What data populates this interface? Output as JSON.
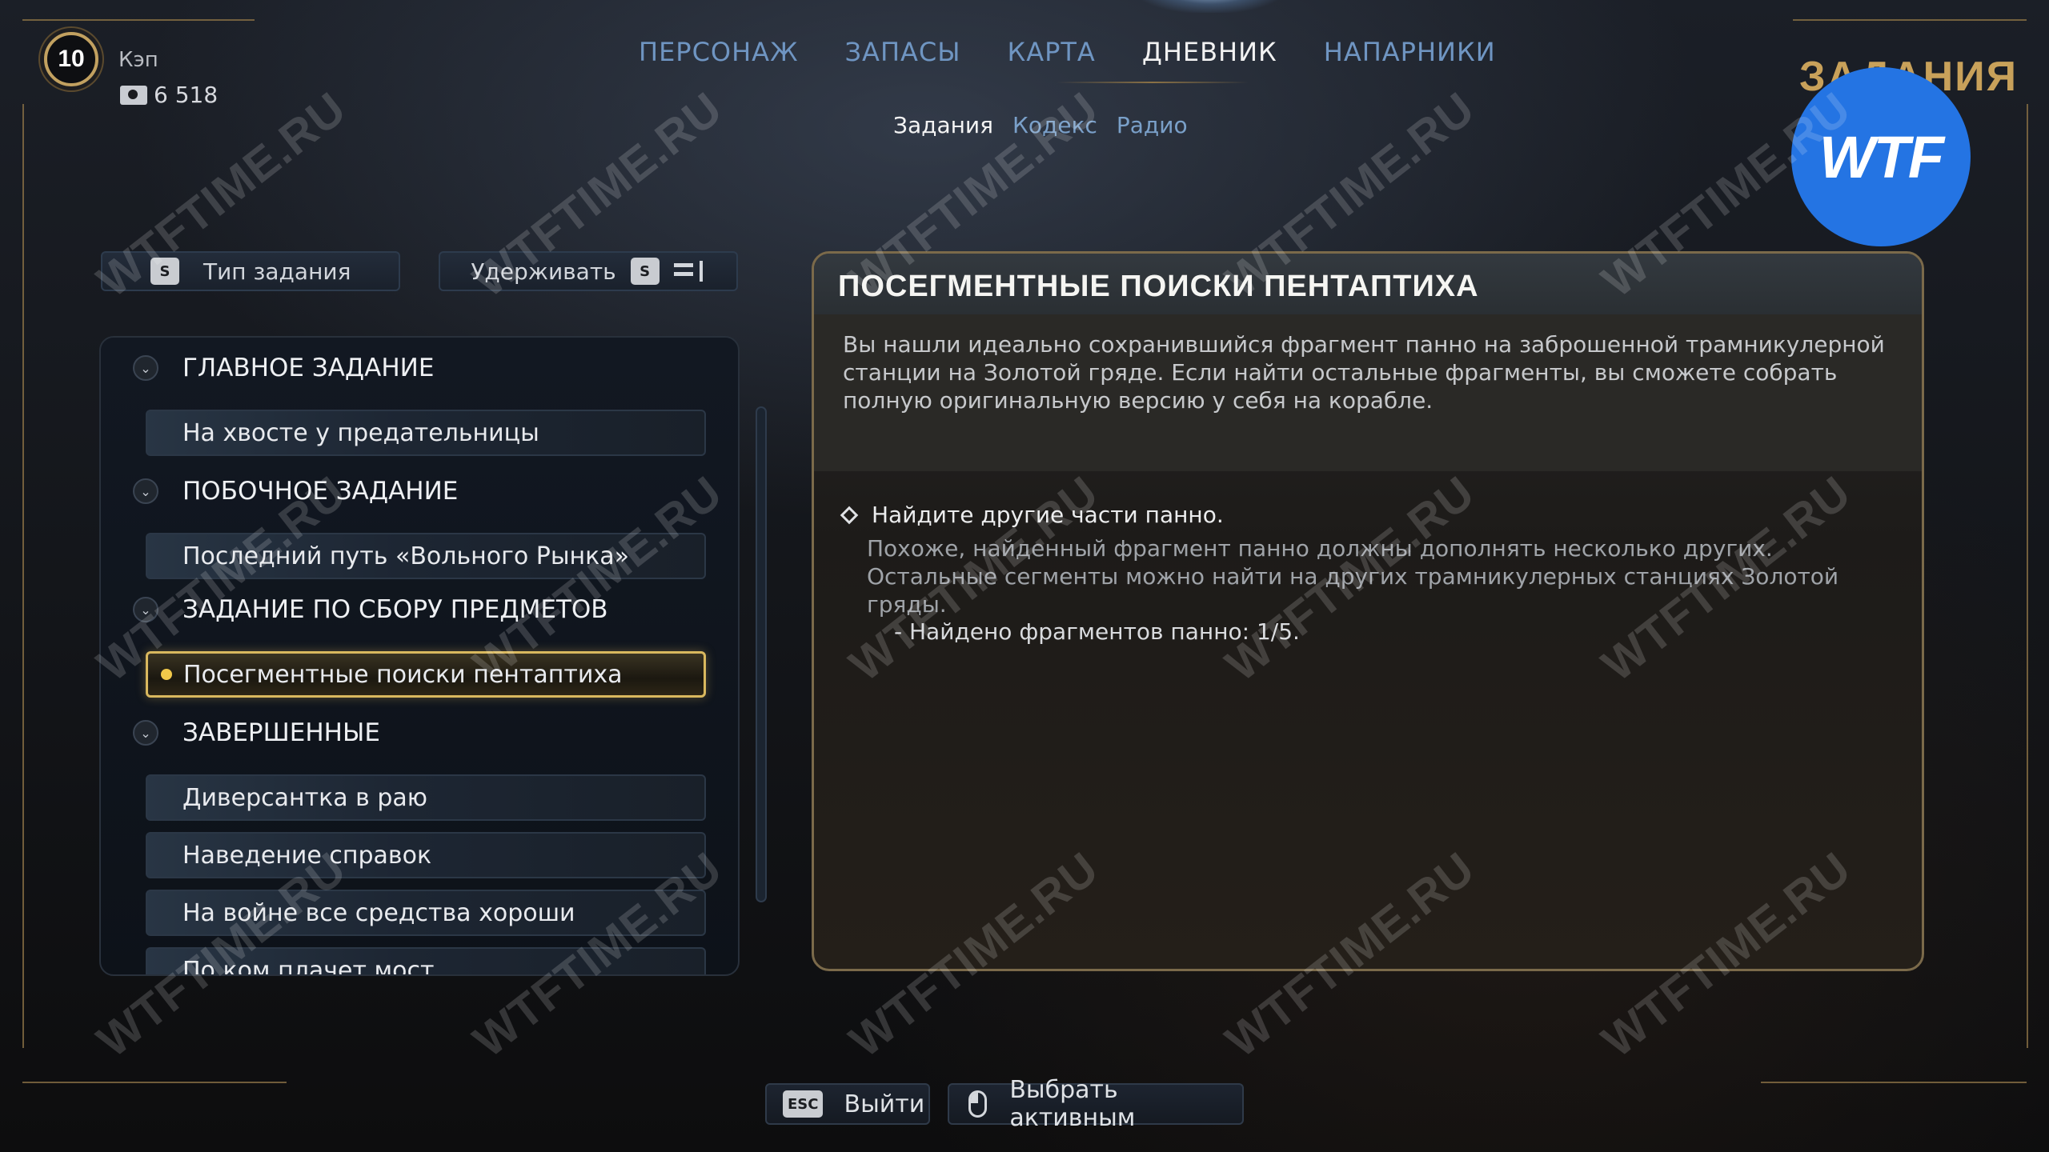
{
  "player": {
    "level": "10",
    "name": "Кэп",
    "money": "6 518"
  },
  "nav": {
    "tabs": [
      "ПЕРСОНАЖ",
      "ЗАПАСЫ",
      "КАРТА",
      "ДНЕВНИК",
      "НАПАРНИКИ"
    ],
    "active_tab": "ДНЕВНИК",
    "subtabs": [
      "Задания",
      "Кодекс",
      "Радио"
    ],
    "active_subtab": "Задания"
  },
  "section_title": "ЗАДАНИЯ",
  "watermark": {
    "badge": "WTF",
    "text": "WTFTIME.RU"
  },
  "controls": {
    "filter_key": "S",
    "filter_label": "Тип задания",
    "hold_label": "Удерживать",
    "hold_key": "S"
  },
  "quest_list": {
    "categories": [
      {
        "title": "ГЛАВНОЕ ЗАДАНИЕ",
        "items": [
          "На хвосте у предательницы"
        ]
      },
      {
        "title": "ПОБОЧНОЕ ЗАДАНИЕ",
        "items": [
          "Последний путь «Вольного Рынка»"
        ]
      },
      {
        "title": "ЗАДАНИЕ ПО СБОРУ ПРЕДМЕТОВ",
        "items": [
          "Посегментные поиски пентаптиха"
        ]
      },
      {
        "title": "ЗАВЕРШЕННЫЕ",
        "items": [
          "Диверсантка в раю",
          "Наведение справок",
          "На войне все средства хороши",
          "По ком плачет мост"
        ]
      }
    ],
    "active_item": "Посегментные поиски пентаптиха"
  },
  "detail": {
    "title": "ПОСЕГМЕНТНЫЕ ПОИСКИ ПЕНТАПТИХА",
    "description": "Вы нашли идеально сохранившийся фрагмент панно на заброшенной трамникулерной станции на Золотой гряде. Если найти остальные фрагменты, вы сможете собрать полную оригинальную версию у себя на корабле.",
    "objective_title": "Найдите другие части панно.",
    "objective_desc": "Похоже, найденный фрагмент панно должны дополнять несколько других. Остальные сегменты можно найти на других трамникулерных станциях Золотой гряды.",
    "objective_progress": "- Найдено фрагментов панно: 1/5."
  },
  "bottom": {
    "exit_key": "ESC",
    "exit_label": "Выйти",
    "select_label": "Выбрать активным"
  }
}
